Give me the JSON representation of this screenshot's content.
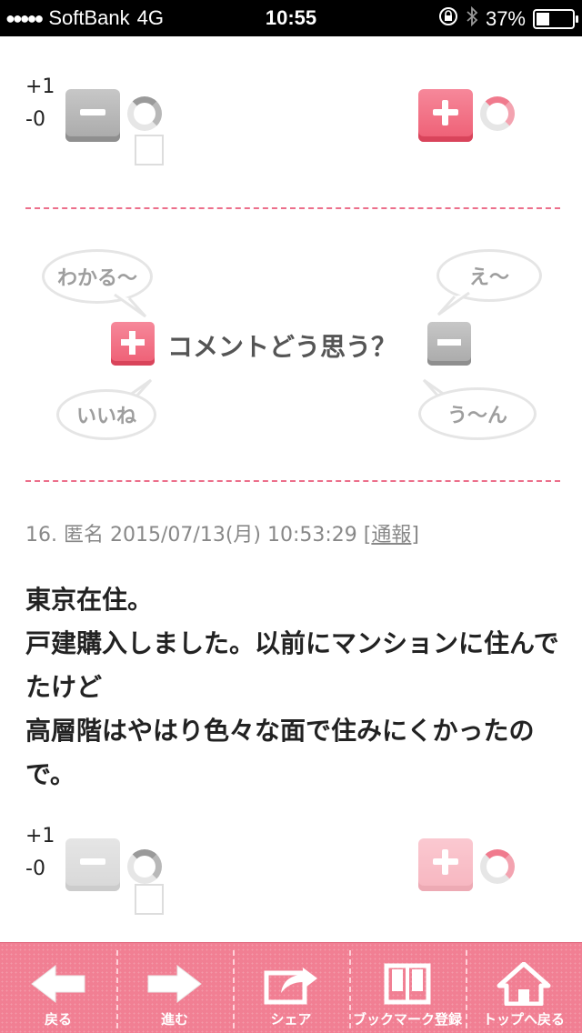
{
  "status_bar": {
    "signal": "●●●●●",
    "carrier": "SoftBank",
    "network": "4G",
    "time": "10:55",
    "battery_percent": "37%",
    "battery_level": 0.37
  },
  "vote_top": {
    "plus_count": "+1",
    "minus_count": "-0"
  },
  "reactions": {
    "wakaru": "わかる〜",
    "ee": "え〜",
    "iine": "いいね",
    "uun": "う〜ん",
    "comment_prompt": "コメントどう思う？"
  },
  "comment": {
    "number": "16.",
    "author": "匿名",
    "timestamp": "2015/07/13(月) 10:53:29",
    "report_open": "[",
    "report_label": "通報",
    "report_close": "]",
    "lines": [
      "東京在住。",
      "戸建購入しました。以前にマンションに住んでたけど",
      "高層階はやはり色々な面で住みにくかったので。"
    ]
  },
  "vote_bottom": {
    "plus_count": "+1",
    "minus_count": "-0"
  },
  "toolbar": {
    "back": "戻る",
    "forward": "進む",
    "share": "シェア",
    "bookmark": "ブックマーク登録",
    "top": "トップへ戻る"
  },
  "colors": {
    "accent_pink": "#ee5e74",
    "gray_button": "#a9a9a9",
    "toolbar": "#f17f93"
  }
}
